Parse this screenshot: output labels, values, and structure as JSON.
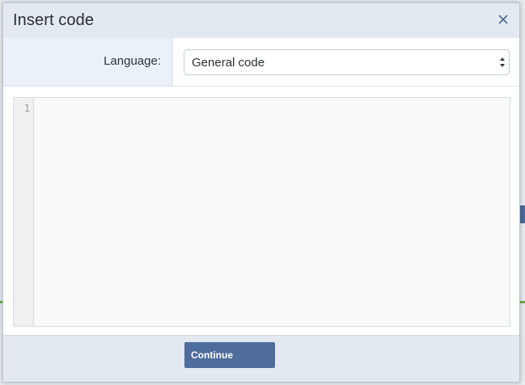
{
  "dialog": {
    "title": "Insert code",
    "close_icon": "close-icon"
  },
  "language": {
    "label": "Language:",
    "selected": "General code"
  },
  "editor": {
    "line_numbers": [
      "1"
    ],
    "content": ""
  },
  "footer": {
    "continue_label": "Continue"
  },
  "colors": {
    "header_bg": "#e3e9f0",
    "label_cell_bg": "#eaf1f8",
    "button_bg": "#4f6d9c",
    "editor_bg": "#f9f9f9"
  }
}
